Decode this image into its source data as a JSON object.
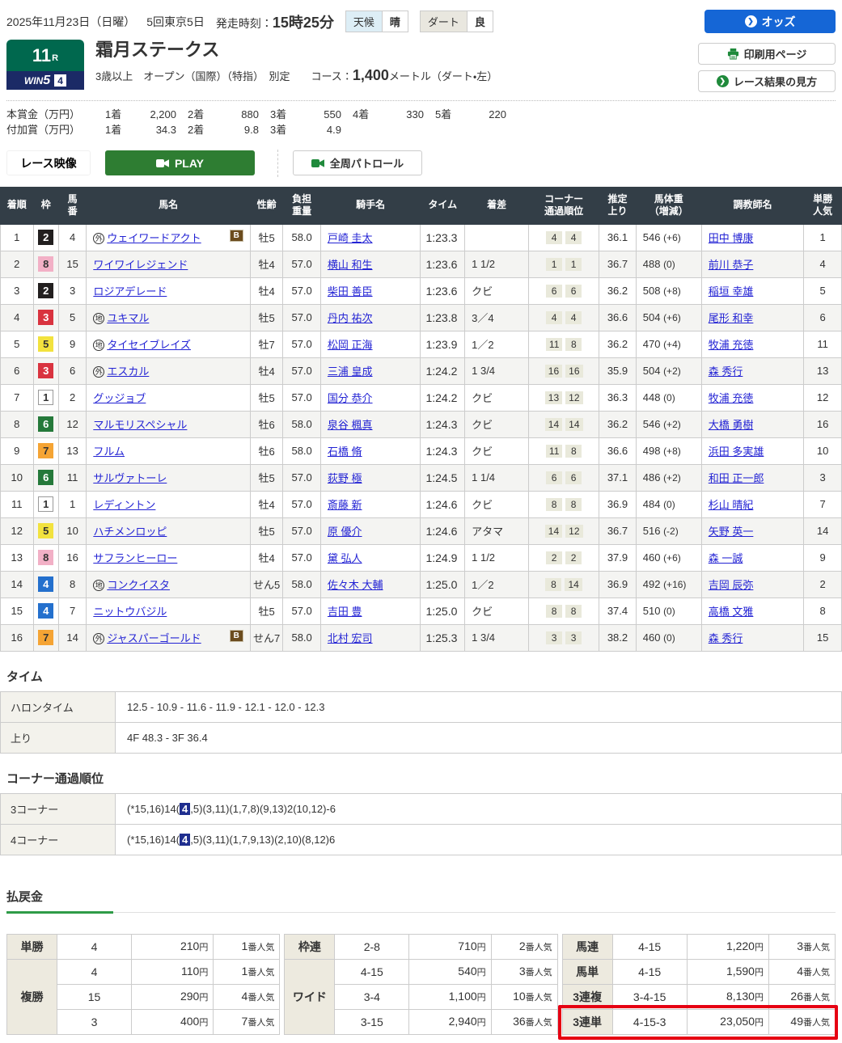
{
  "header": {
    "date": "2025年11月23日（日曜）",
    "meeting": "5回東京5日",
    "start_label": "発走時刻：",
    "start_time": "15時25分",
    "weather_label": "天候",
    "weather_value": "晴",
    "track_label": "ダート",
    "track_value": "良",
    "odds_button": "オッズ",
    "print_button": "印刷用ページ",
    "guide_button": "レース結果の見方"
  },
  "icons": {
    "odds_arrow": "❯",
    "guide_arrow": "❯",
    "printer": "printer-icon",
    "camera": "video-camera-icon"
  },
  "race": {
    "number": "11",
    "number_suffix": "R",
    "win5_logo": "WIN",
    "win5_five": "5",
    "win5_num": "4",
    "title": "霜月ステークス",
    "conditions": "3歳以上　オープン（国際）（特指）　別定",
    "course_label": "コース：",
    "course_value": "1,400",
    "course_suffix": "メートル（ダート・左）"
  },
  "prize": {
    "main_label": "本賞金（万円）",
    "main": [
      {
        "rank": "1着",
        "value": "2,200"
      },
      {
        "rank": "2着",
        "value": "880"
      },
      {
        "rank": "3着",
        "value": "550"
      },
      {
        "rank": "4着",
        "value": "330"
      },
      {
        "rank": "5着",
        "value": "220"
      }
    ],
    "extra_label": "付加賞（万円）",
    "extra": [
      {
        "rank": "1着",
        "value": "34.3"
      },
      {
        "rank": "2着",
        "value": "9.8"
      },
      {
        "rank": "3着",
        "value": "4.9"
      }
    ]
  },
  "video": {
    "race_video": "レース映像",
    "play": "PLAY",
    "patrol": "全周パトロール"
  },
  "results": {
    "blinker_label": "B",
    "headers": [
      "着順",
      "枠",
      "馬\n番",
      "馬名",
      "性齢",
      "負担\n重量",
      "騎手名",
      "タイム",
      "着差",
      "コーナー\n通過順位",
      "推定\n上り",
      "馬体重\n（増減）",
      "調教師名",
      "単勝\n人気"
    ],
    "rows": [
      {
        "pos": "1",
        "waku": "2",
        "num": "4",
        "mark": "外",
        "name": "ウェイワードアクト",
        "blinker": true,
        "sexage": "牡5",
        "load": "58.0",
        "jockey": "戸崎 圭太",
        "time": "1:23.3",
        "margin": "",
        "corners": [
          "4",
          "4"
        ],
        "up": "36.1",
        "bw": "546",
        "bwdiff": "(+6)",
        "trainer": "田中 博康",
        "pop": "1"
      },
      {
        "pos": "2",
        "waku": "8",
        "num": "15",
        "mark": "",
        "name": "ワイワイレジェンド",
        "blinker": false,
        "sexage": "牡4",
        "load": "57.0",
        "jockey": "横山 和生",
        "time": "1:23.6",
        "margin": "1 1/2",
        "corners": [
          "1",
          "1"
        ],
        "up": "36.7",
        "bw": "488",
        "bwdiff": "(0)",
        "trainer": "前川 恭子",
        "pop": "4"
      },
      {
        "pos": "3",
        "waku": "2",
        "num": "3",
        "mark": "",
        "name": "ロジアデレード",
        "blinker": false,
        "sexage": "牡4",
        "load": "57.0",
        "jockey": "柴田 善臣",
        "time": "1:23.6",
        "margin": "クビ",
        "corners": [
          "6",
          "6"
        ],
        "up": "36.2",
        "bw": "508",
        "bwdiff": "(+8)",
        "trainer": "稲垣 幸雄",
        "pop": "5"
      },
      {
        "pos": "4",
        "waku": "3",
        "num": "5",
        "mark": "地",
        "name": "ユキマル",
        "blinker": false,
        "sexage": "牡5",
        "load": "57.0",
        "jockey": "丹内 祐次",
        "time": "1:23.8",
        "margin": "3／4",
        "corners": [
          "4",
          "4"
        ],
        "up": "36.6",
        "bw": "504",
        "bwdiff": "(+6)",
        "trainer": "尾形 和幸",
        "pop": "6"
      },
      {
        "pos": "5",
        "waku": "5",
        "num": "9",
        "mark": "地",
        "name": "タイセイブレイズ",
        "blinker": false,
        "sexage": "牡7",
        "load": "57.0",
        "jockey": "松岡 正海",
        "time": "1:23.9",
        "margin": "1／2",
        "corners": [
          "11",
          "8"
        ],
        "up": "36.2",
        "bw": "470",
        "bwdiff": "(+4)",
        "trainer": "牧浦 充徳",
        "pop": "11"
      },
      {
        "pos": "6",
        "waku": "3",
        "num": "6",
        "mark": "外",
        "name": "エスカル",
        "blinker": false,
        "sexage": "牡4",
        "load": "57.0",
        "jockey": "三浦 皇成",
        "time": "1:24.2",
        "margin": "1 3/4",
        "corners": [
          "16",
          "16"
        ],
        "up": "35.9",
        "bw": "504",
        "bwdiff": "(+2)",
        "trainer": "森 秀行",
        "pop": "13"
      },
      {
        "pos": "7",
        "waku": "1",
        "num": "2",
        "mark": "",
        "name": "グッジョブ",
        "blinker": false,
        "sexage": "牡5",
        "load": "57.0",
        "jockey": "国分 恭介",
        "time": "1:24.2",
        "margin": "クビ",
        "corners": [
          "13",
          "12"
        ],
        "up": "36.3",
        "bw": "448",
        "bwdiff": "(0)",
        "trainer": "牧浦 充徳",
        "pop": "12"
      },
      {
        "pos": "8",
        "waku": "6",
        "num": "12",
        "mark": "",
        "name": "マルモリスペシャル",
        "blinker": false,
        "sexage": "牡6",
        "load": "58.0",
        "jockey": "泉谷 楓真",
        "time": "1:24.3",
        "margin": "クビ",
        "corners": [
          "14",
          "14"
        ],
        "up": "36.2",
        "bw": "546",
        "bwdiff": "(+2)",
        "trainer": "大橋 勇樹",
        "pop": "16"
      },
      {
        "pos": "9",
        "waku": "7",
        "num": "13",
        "mark": "",
        "name": "フルム",
        "blinker": false,
        "sexage": "牡6",
        "load": "58.0",
        "jockey": "石橋 脩",
        "time": "1:24.3",
        "margin": "クビ",
        "corners": [
          "11",
          "8"
        ],
        "up": "36.6",
        "bw": "498",
        "bwdiff": "(+8)",
        "trainer": "浜田 多実雄",
        "pop": "10"
      },
      {
        "pos": "10",
        "waku": "6",
        "num": "11",
        "mark": "",
        "name": "サルヴァトーレ",
        "blinker": false,
        "sexage": "牡5",
        "load": "57.0",
        "jockey": "荻野 極",
        "time": "1:24.5",
        "margin": "1 1/4",
        "corners": [
          "6",
          "6"
        ],
        "up": "37.1",
        "bw": "486",
        "bwdiff": "(+2)",
        "trainer": "和田 正一郎",
        "pop": "3"
      },
      {
        "pos": "11",
        "waku": "1",
        "num": "1",
        "mark": "",
        "name": "レディントン",
        "blinker": false,
        "sexage": "牡4",
        "load": "57.0",
        "jockey": "斎藤 新",
        "time": "1:24.6",
        "margin": "クビ",
        "corners": [
          "8",
          "8"
        ],
        "up": "36.9",
        "bw": "484",
        "bwdiff": "(0)",
        "trainer": "杉山 晴紀",
        "pop": "7"
      },
      {
        "pos": "12",
        "waku": "5",
        "num": "10",
        "mark": "",
        "name": "ハチメンロッピ",
        "blinker": false,
        "sexage": "牡5",
        "load": "57.0",
        "jockey": "原 優介",
        "time": "1:24.6",
        "margin": "アタマ",
        "corners": [
          "14",
          "12"
        ],
        "up": "36.7",
        "bw": "516",
        "bwdiff": "(-2)",
        "trainer": "矢野 英一",
        "pop": "14"
      },
      {
        "pos": "13",
        "waku": "8",
        "num": "16",
        "mark": "",
        "name": "サフランヒーロー",
        "blinker": false,
        "sexage": "牡4",
        "load": "57.0",
        "jockey": "黛 弘人",
        "time": "1:24.9",
        "margin": "1 1/2",
        "corners": [
          "2",
          "2"
        ],
        "up": "37.9",
        "bw": "460",
        "bwdiff": "(+6)",
        "trainer": "森 一誠",
        "pop": "9"
      },
      {
        "pos": "14",
        "waku": "4",
        "num": "8",
        "mark": "地",
        "name": "コンクイスタ",
        "blinker": false,
        "sexage": "せん5",
        "load": "58.0",
        "jockey": "佐々木 大輔",
        "time": "1:25.0",
        "margin": "1／2",
        "corners": [
          "8",
          "14"
        ],
        "up": "36.9",
        "bw": "492",
        "bwdiff": "(+16)",
        "trainer": "吉岡 辰弥",
        "pop": "2"
      },
      {
        "pos": "15",
        "waku": "4",
        "num": "7",
        "mark": "",
        "name": "ニットウバジル",
        "blinker": false,
        "sexage": "牡5",
        "load": "57.0",
        "jockey": "吉田 豊",
        "time": "1:25.0",
        "margin": "クビ",
        "corners": [
          "8",
          "8"
        ],
        "up": "37.4",
        "bw": "510",
        "bwdiff": "(0)",
        "trainer": "高橋 文雅",
        "pop": "8"
      },
      {
        "pos": "16",
        "waku": "7",
        "num": "14",
        "mark": "外",
        "name": "ジャスパーゴールド",
        "blinker": true,
        "sexage": "せん7",
        "load": "58.0",
        "jockey": "北村 宏司",
        "time": "1:25.3",
        "margin": "1 3/4",
        "corners": [
          "3",
          "3"
        ],
        "up": "38.2",
        "bw": "460",
        "bwdiff": "(0)",
        "trainer": "森 秀行",
        "pop": "15"
      }
    ]
  },
  "timing": {
    "title": "タイム",
    "rows": [
      {
        "label": "ハロンタイム",
        "value": "12.5 - 10.9 - 11.6 - 11.9 - 12.1 - 12.0 - 12.3"
      },
      {
        "label": "上り",
        "value": "4F 48.3 - 3F 36.4"
      }
    ]
  },
  "corner": {
    "title": "コーナー通過順位",
    "rows": [
      {
        "label": "3コーナー",
        "pre": "(*15,16)14(",
        "hi": "4",
        "post": ",5)(3,11)(1,7,8)(9,13)2(10,12)-6"
      },
      {
        "label": "4コーナー",
        "pre": "(*15,16)14(",
        "hi": "4",
        "post": ",5)(3,11)(1,7,9,13)(2,10)(8,12)6"
      }
    ]
  },
  "payout": {
    "title": "払戻金",
    "yen_suffix": "円",
    "pop_suffix": "番人気",
    "tables": [
      {
        "groups": [
          {
            "label": "単勝",
            "rows": [
              {
                "combo": "4",
                "amount": "210",
                "pop": "1"
              }
            ]
          },
          {
            "label": "複勝",
            "rows": [
              {
                "combo": "4",
                "amount": "110",
                "pop": "1"
              },
              {
                "combo": "15",
                "amount": "290",
                "pop": "4"
              },
              {
                "combo": "3",
                "amount": "400",
                "pop": "7"
              }
            ]
          }
        ]
      },
      {
        "groups": [
          {
            "label": "枠連",
            "rows": [
              {
                "combo": "2-8",
                "amount": "710",
                "pop": "2"
              }
            ]
          },
          {
            "label": "ワイド",
            "rows": [
              {
                "combo": "4-15",
                "amount": "540",
                "pop": "3"
              },
              {
                "combo": "3-4",
                "amount": "1,100",
                "pop": "10"
              },
              {
                "combo": "3-15",
                "amount": "2,940",
                "pop": "36"
              }
            ]
          }
        ]
      },
      {
        "groups": [
          {
            "label": "馬連",
            "rows": [
              {
                "combo": "4-15",
                "amount": "1,220",
                "pop": "3"
              }
            ]
          },
          {
            "label": "馬単",
            "rows": [
              {
                "combo": "4-15",
                "amount": "1,590",
                "pop": "4"
              }
            ]
          },
          {
            "label": "3連複",
            "rows": [
              {
                "combo": "3-4-15",
                "amount": "8,130",
                "pop": "26"
              }
            ]
          },
          {
            "label": "3連単",
            "rows": [
              {
                "combo": "4-15-3",
                "amount": "23,050",
                "pop": "49"
              }
            ],
            "highlight": true
          }
        ]
      }
    ]
  }
}
